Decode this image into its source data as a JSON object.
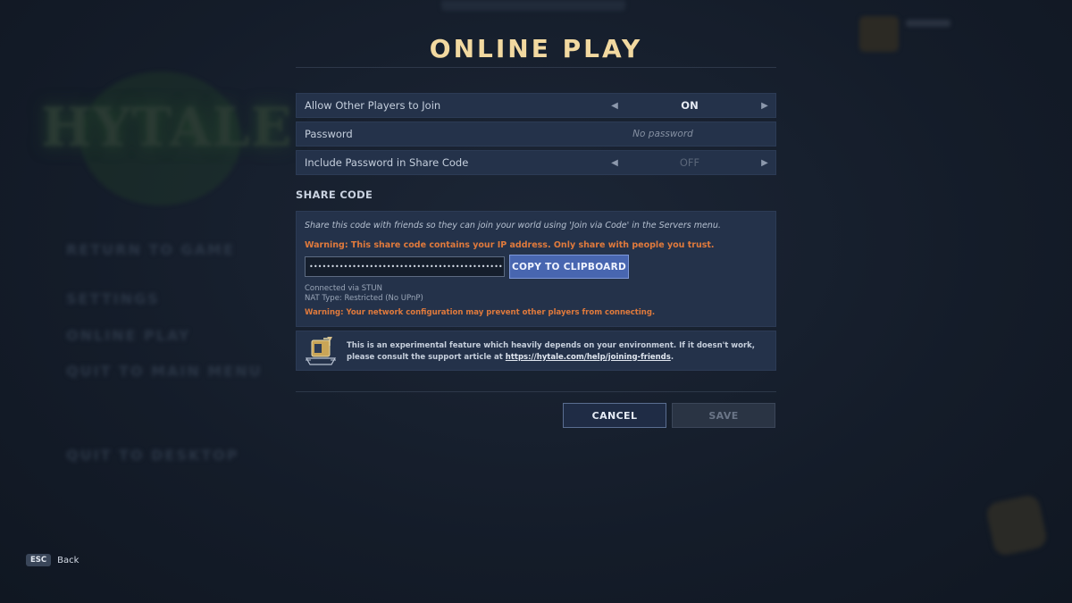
{
  "background": {
    "logo_text": "HYTALE",
    "menu_items": [
      "RETURN TO GAME",
      "SETTINGS",
      "ONLINE PLAY",
      "QUIT TO MAIN MENU",
      "QUIT TO DESKTOP"
    ]
  },
  "dialog": {
    "title": "ONLINE PLAY",
    "settings": [
      {
        "label": "Allow Other Players to Join",
        "value": "ON",
        "type": "toggle"
      },
      {
        "label": "Password",
        "value": "No password",
        "type": "text"
      },
      {
        "label": "Include Password in Share Code",
        "value": "OFF",
        "type": "toggle"
      }
    ],
    "share_code": {
      "section_title": "SHARE CODE",
      "description": "Share this code with friends so they can join your world using 'Join via Code' in the Servers menu.",
      "warning": "Warning: This share code contains your IP address. Only share with people you trust.",
      "code_value": "••••••••••••••••••••••••••••••••••••••••••••••••••••••••••••••••",
      "copy_label": "COPY TO CLIPBOARD",
      "connection": "Connected via STUN",
      "nat_type": "NAT Type: Restricted (No UPnP)",
      "network_warning": "Warning: Your network configuration may prevent other players from connecting."
    },
    "info": {
      "text": "This is an experimental feature which heavily depends on your environment. If it doesn't work, please consult the support article at ",
      "link": "https://hytale.com/help/joining-friends",
      "suffix": "."
    },
    "buttons": {
      "cancel": "CANCEL",
      "save": "SAVE"
    }
  },
  "hint": {
    "key": "ESC",
    "label": "Back"
  },
  "colors": {
    "title": "#f2d9a0",
    "warning": "#e07a3c",
    "panel": "#24324a",
    "accent_button": "#4866b0"
  }
}
